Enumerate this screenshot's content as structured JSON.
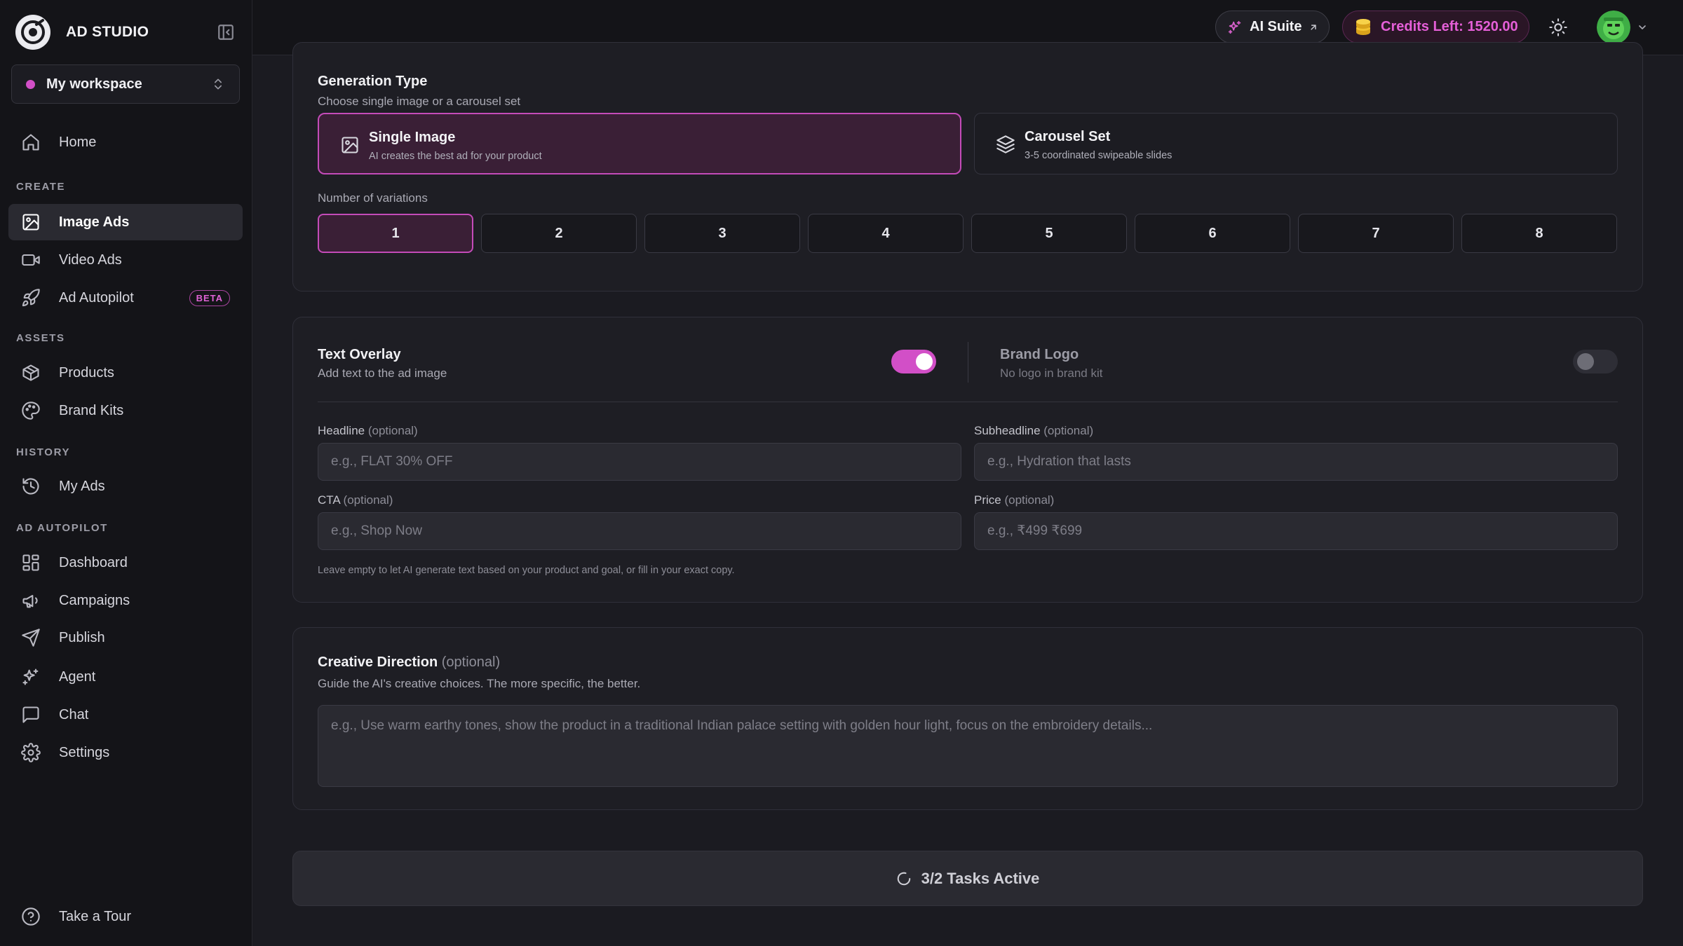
{
  "app": {
    "name": "AD STUDIO"
  },
  "workspace": {
    "name": "My workspace",
    "dot_color": "#d24fc7"
  },
  "sidebar": {
    "home": {
      "label": "Home",
      "icon": "home-icon"
    },
    "sections": {
      "create": "CREATE",
      "assets": "ASSETS",
      "history": "HISTORY",
      "autopilot": "AD AUTOPILOT"
    },
    "items": {
      "image_ads": {
        "label": "Image Ads",
        "icon": "image-icon",
        "active": true
      },
      "video_ads": {
        "label": "Video Ads",
        "icon": "video-icon"
      },
      "ad_autopilot": {
        "label": "Ad Autopilot",
        "icon": "rocket-icon",
        "badge": "BETA"
      },
      "products": {
        "label": "Products",
        "icon": "box-icon"
      },
      "brand_kits": {
        "label": "Brand Kits",
        "icon": "palette-icon"
      },
      "my_ads": {
        "label": "My Ads",
        "icon": "history-icon"
      },
      "dashboard": {
        "label": "Dashboard",
        "icon": "dashboard-icon"
      },
      "campaigns": {
        "label": "Campaigns",
        "icon": "megaphone-icon"
      },
      "publish": {
        "label": "Publish",
        "icon": "send-icon"
      },
      "agent": {
        "label": "Agent",
        "icon": "sparkles-icon"
      },
      "chat": {
        "label": "Chat",
        "icon": "chat-icon"
      },
      "settings": {
        "label": "Settings",
        "icon": "gear-icon"
      }
    },
    "tour": {
      "label": "Take a Tour",
      "icon": "help-circle-icon"
    }
  },
  "topbar": {
    "ai_suite": "AI Suite",
    "credits": "Credits Left: 1520.00",
    "accent_color": "#e55fd8"
  },
  "generation": {
    "title": "Generation Type",
    "subtitle": "Choose single image or a carousel set",
    "options": [
      {
        "title": "Single Image",
        "subtitle": "AI creates the best ad for your product",
        "selected": true
      },
      {
        "title": "Carousel Set",
        "subtitle": "3-5 coordinated swipeable slides",
        "selected": false
      }
    ],
    "variations_label": "Number of variations",
    "variations": [
      "1",
      "2",
      "3",
      "4",
      "5",
      "6",
      "7",
      "8"
    ],
    "selected_variation": "1"
  },
  "overlay": {
    "text_overlay": {
      "title": "Text Overlay",
      "subtitle": "Add text to the ad image",
      "on": true
    },
    "brand_logo": {
      "title": "Brand Logo",
      "subtitle": "No logo in brand kit",
      "on": false
    },
    "optional": "(optional)",
    "fields": {
      "headline": {
        "label": "Headline",
        "placeholder": "e.g., FLAT 30% OFF"
      },
      "subheadline": {
        "label": "Subheadline",
        "placeholder": "e.g., Hydration that lasts"
      },
      "cta": {
        "label": "CTA",
        "placeholder": "e.g., Shop Now"
      },
      "price": {
        "label": "Price",
        "placeholder": "e.g., ₹499 ₹699"
      }
    },
    "hint": "Leave empty to let AI generate text based on your product and goal, or fill in your exact copy."
  },
  "creative": {
    "title": "Creative Direction",
    "optional": "(optional)",
    "subtitle": "Guide the AI's creative choices. The more specific, the better.",
    "placeholder": "e.g., Use warm earthy tones, show the product in a traditional Indian palace setting with golden hour light, focus on the embroidery details..."
  },
  "tasks": {
    "label": "3/2 Tasks Active"
  }
}
